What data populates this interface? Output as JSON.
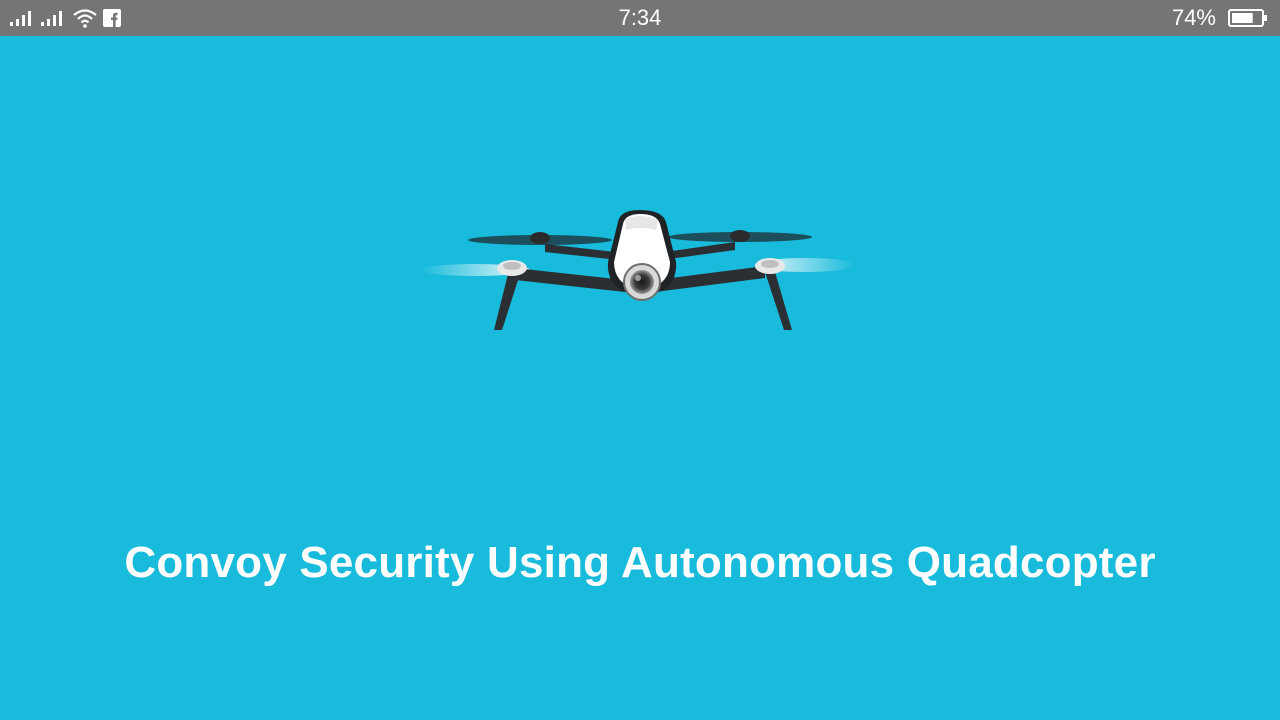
{
  "status_bar": {
    "time": "7:34",
    "battery_percent": "74%",
    "battery_level": 0.74,
    "icons": [
      "signal-icon",
      "signal-icon",
      "wifi-icon",
      "facebook-icon",
      "battery-icon"
    ]
  },
  "splash": {
    "title": "Convoy Security Using Autonomous Quadcopter",
    "image": "drone-image"
  },
  "colors": {
    "background": "#18BBDB",
    "status_bar": "#757575",
    "title_text": "#FFFFFF"
  }
}
